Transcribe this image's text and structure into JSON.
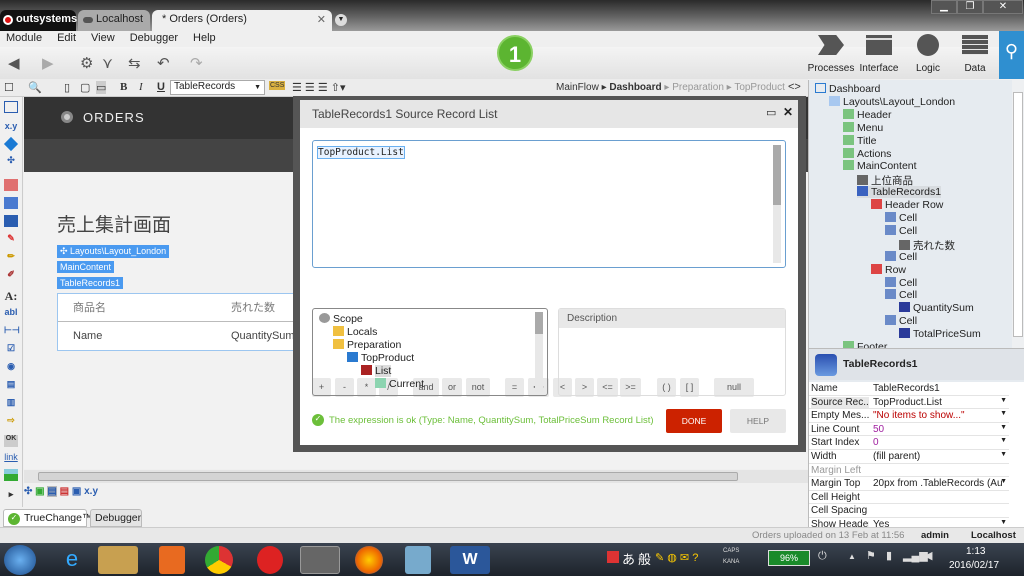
{
  "titlebar": {
    "brand": "outsystems",
    "tabs": [
      "Localhost",
      "* Orders (Orders)"
    ],
    "window_buttons": [
      "minimize",
      "restore",
      "close"
    ]
  },
  "menu": [
    "Module",
    "Edit",
    "View",
    "Debugger",
    "Help"
  ],
  "toolbar": {
    "badge": "1",
    "badge_color": "#5cb531",
    "apps": [
      "Processes",
      "Interface",
      "Logic",
      "Data"
    ],
    "search_color": "#2f8fd0"
  },
  "subtoolbar": {
    "style_select": "TableRecords",
    "css": "CSS",
    "breadcrumb": [
      "MainFlow",
      "Dashboard",
      "Preparation",
      "TopProduct"
    ],
    "code_toggle": "<>"
  },
  "palette_extra": {
    "x_y": "x.y",
    "ok": "OK",
    "link": "link"
  },
  "canvas": {
    "header": "ORDERS",
    "title": "売上集計画面",
    "tags": [
      "Layouts\\Layout_London",
      "MainContent",
      "TableRecords1"
    ],
    "table_headers": [
      "商品名",
      "売れた数"
    ],
    "table_row": [
      "Name",
      "QuantitySum"
    ]
  },
  "bottom_icons_label": "x.y",
  "bottom_tabs": [
    "TrueChange™",
    "Debugger"
  ],
  "dialog": {
    "title": "TableRecords1 Source Record List",
    "expression": "TopProduct.List",
    "operators": [
      "+",
      "-",
      "*",
      "/",
      "and",
      "or",
      "not",
      "=",
      "<>",
      "<",
      ">",
      "<=",
      ">=",
      "( )",
      "[ ]",
      "null"
    ],
    "scope_tree": [
      {
        "label": "Scope",
        "level": 0
      },
      {
        "label": "Locals",
        "level": 1
      },
      {
        "label": "Preparation",
        "level": 1
      },
      {
        "label": "TopProduct",
        "level": 2
      },
      {
        "label": "List",
        "level": 3
      },
      {
        "label": "Current",
        "level": 4
      }
    ],
    "description_label": "Description",
    "status": "The expression is ok (Type: Name, QuantitySum, TotalPriceSum Record List)",
    "status_color": "#6cbf3a",
    "done": "DONE",
    "help": "HELP",
    "done_color": "#cc2200"
  },
  "tree": [
    {
      "label": "Dashboard",
      "level": 0
    },
    {
      "label": "Layouts\\Layout_London",
      "level": 1
    },
    {
      "label": "Header",
      "level": 2
    },
    {
      "label": "Menu",
      "level": 2
    },
    {
      "label": "Title",
      "level": 2
    },
    {
      "label": "Actions",
      "level": 2
    },
    {
      "label": "MainContent",
      "level": 2
    },
    {
      "label": "上位商品",
      "level": 3
    },
    {
      "label": "TableRecords1",
      "level": 3
    },
    {
      "label": "Header Row",
      "level": 4
    },
    {
      "label": "Cell",
      "level": 5
    },
    {
      "label": "Cell",
      "level": 5
    },
    {
      "label": "売れた数",
      "level": 6
    },
    {
      "label": "Cell",
      "level": 5
    },
    {
      "label": "Row",
      "level": 4
    },
    {
      "label": "Cell",
      "level": 5
    },
    {
      "label": "Cell",
      "level": 5
    },
    {
      "label": "QuantitySum",
      "level": 6
    },
    {
      "label": "Cell",
      "level": 5
    },
    {
      "label": "TotalPriceSum",
      "level": 6
    },
    {
      "label": "Footer",
      "level": 2
    }
  ],
  "properties": {
    "title": "TableRecords1",
    "rows": [
      {
        "k": "Name",
        "v": "TableRecords1"
      },
      {
        "k": "Source Rec...",
        "v": "TopProduct.List"
      },
      {
        "k": "Empty Mes...",
        "v": "\"No items to show...\""
      },
      {
        "k": "Line Count",
        "v": "50"
      },
      {
        "k": "Start Index",
        "v": "0"
      },
      {
        "k": "Width",
        "v": "(fill parent)"
      },
      {
        "k": "Margin Left",
        "v": ""
      },
      {
        "k": "Margin Top",
        "v": "20px from .TableRecords (Au"
      },
      {
        "k": "Cell Height",
        "v": ""
      },
      {
        "k": "Cell Spacing",
        "v": ""
      },
      {
        "k": "Show Header",
        "v": "Yes"
      }
    ]
  },
  "status": {
    "upload": "Orders uploaded on 13 Feb at 11:56",
    "user": "admin",
    "server": "Localhost"
  },
  "taskbar": {
    "ime": [
      "あ",
      "般"
    ],
    "caps": "CAPS",
    "kana": "KANA",
    "battery": "96%",
    "time": "1:13",
    "date": "2016/02/17"
  }
}
